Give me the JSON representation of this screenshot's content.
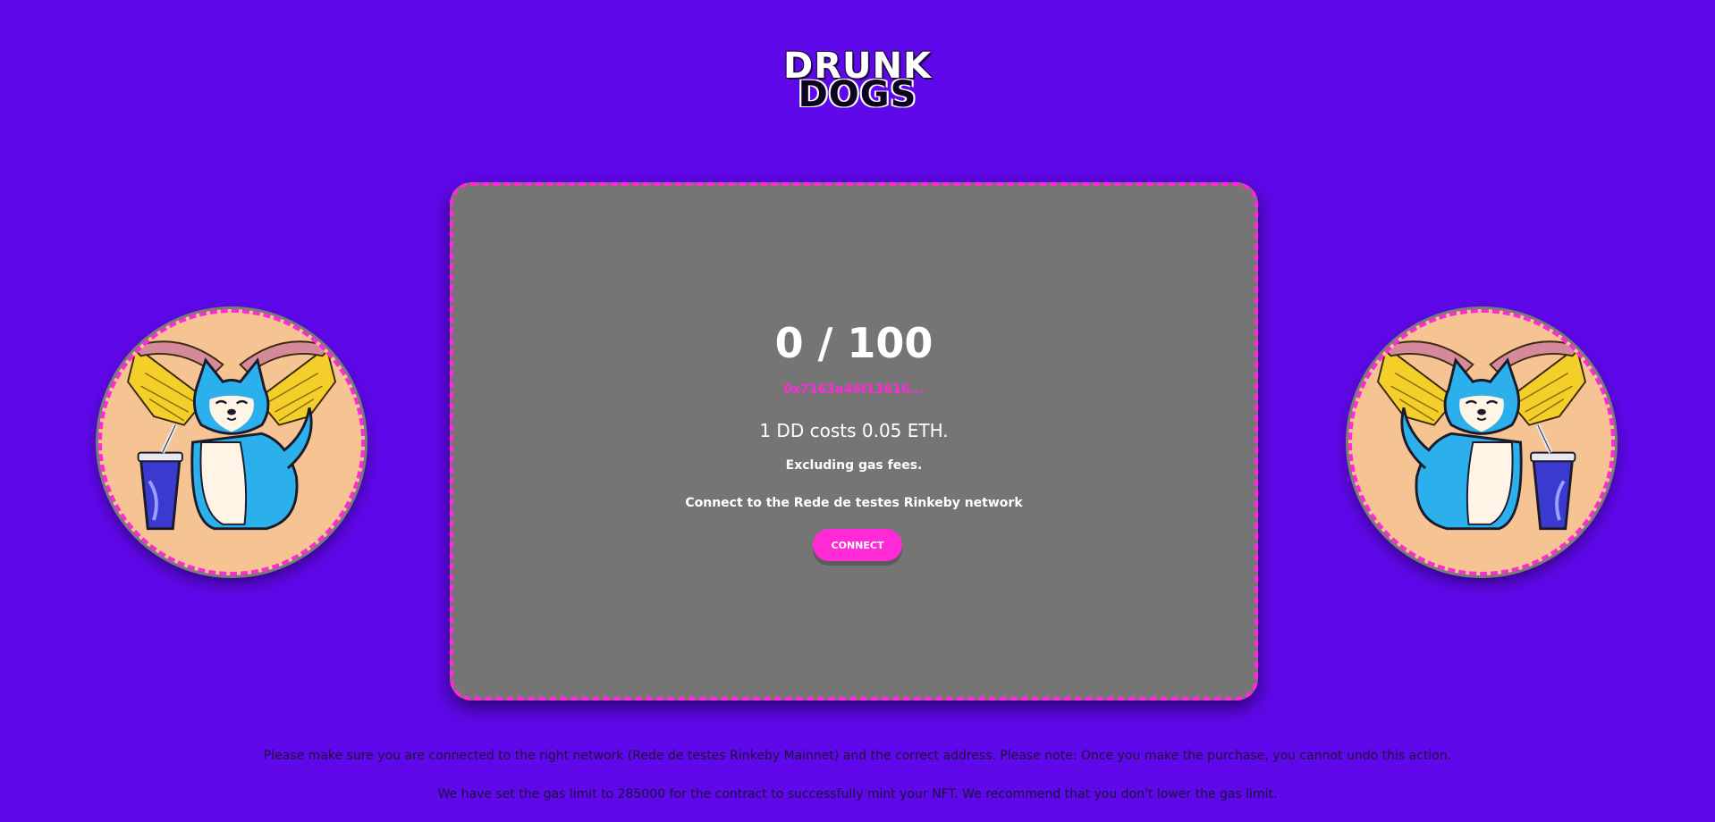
{
  "logo": {
    "line1": "DRUNK",
    "line2": "DOGS"
  },
  "mint": {
    "supply": "0 / 100",
    "contract_address": "0x7163a46f13616...",
    "price": "1 DD costs 0.05 ETH.",
    "fees_note": "Excluding gas fees.",
    "network_prompt": "Connect to the Rede de testes Rinkeby network",
    "connect_label": "CONNECT"
  },
  "notices": {
    "network_notice": "Please make sure you are connected to the right network (Rede de testes Rinkeby Mainnet) and the correct address. Please note: Once you make the purchase, you cannot undo this action.",
    "gas_notice": "We have set the gas limit to 285000 for the contract to successfully mint your NFT. We recommend that you don't lower the gas limit."
  },
  "colors": {
    "background": "#5f08ea",
    "card": "#757575",
    "accent": "#ff2ad6",
    "image_bg": "#f6c493"
  },
  "images": {
    "left": "dog-with-wings-and-drink-icon",
    "right": "dog-with-wings-and-drink-icon"
  }
}
